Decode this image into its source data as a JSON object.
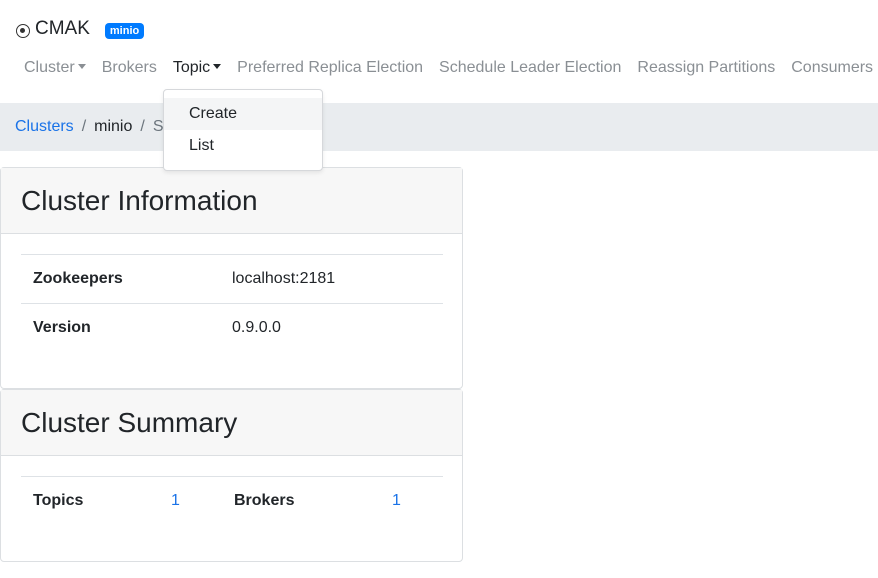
{
  "brand": {
    "name": "CMAK",
    "badge": "minio",
    "icon": "circle-dot-icon"
  },
  "nav": {
    "cluster": "Cluster",
    "brokers": "Brokers",
    "topic": "Topic",
    "preferred_replica_election": "Preferred Replica Election",
    "schedule_leader_election": "Schedule Leader Election",
    "reassign_partitions": "Reassign Partitions",
    "consumers": "Consumers"
  },
  "breadcrumb": {
    "clusters": "Clusters",
    "cluster": "minio",
    "separator": "/",
    "current": "S"
  },
  "dropdown": {
    "items": [
      "Create",
      "List"
    ]
  },
  "cluster_info": {
    "title": "Cluster Information",
    "zookeepers_label": "Zookeepers",
    "zookeepers_value": "localhost:2181",
    "version_label": "Version",
    "version_value": "0.9.0.0"
  },
  "cluster_summary": {
    "title": "Cluster Summary",
    "topics_label": "Topics",
    "topics_value": "1",
    "brokers_label": "Brokers",
    "brokers_value": "1"
  },
  "colors": {
    "accent": "#007bff",
    "link": "#1a73e8",
    "muted": "#8a8f94"
  }
}
